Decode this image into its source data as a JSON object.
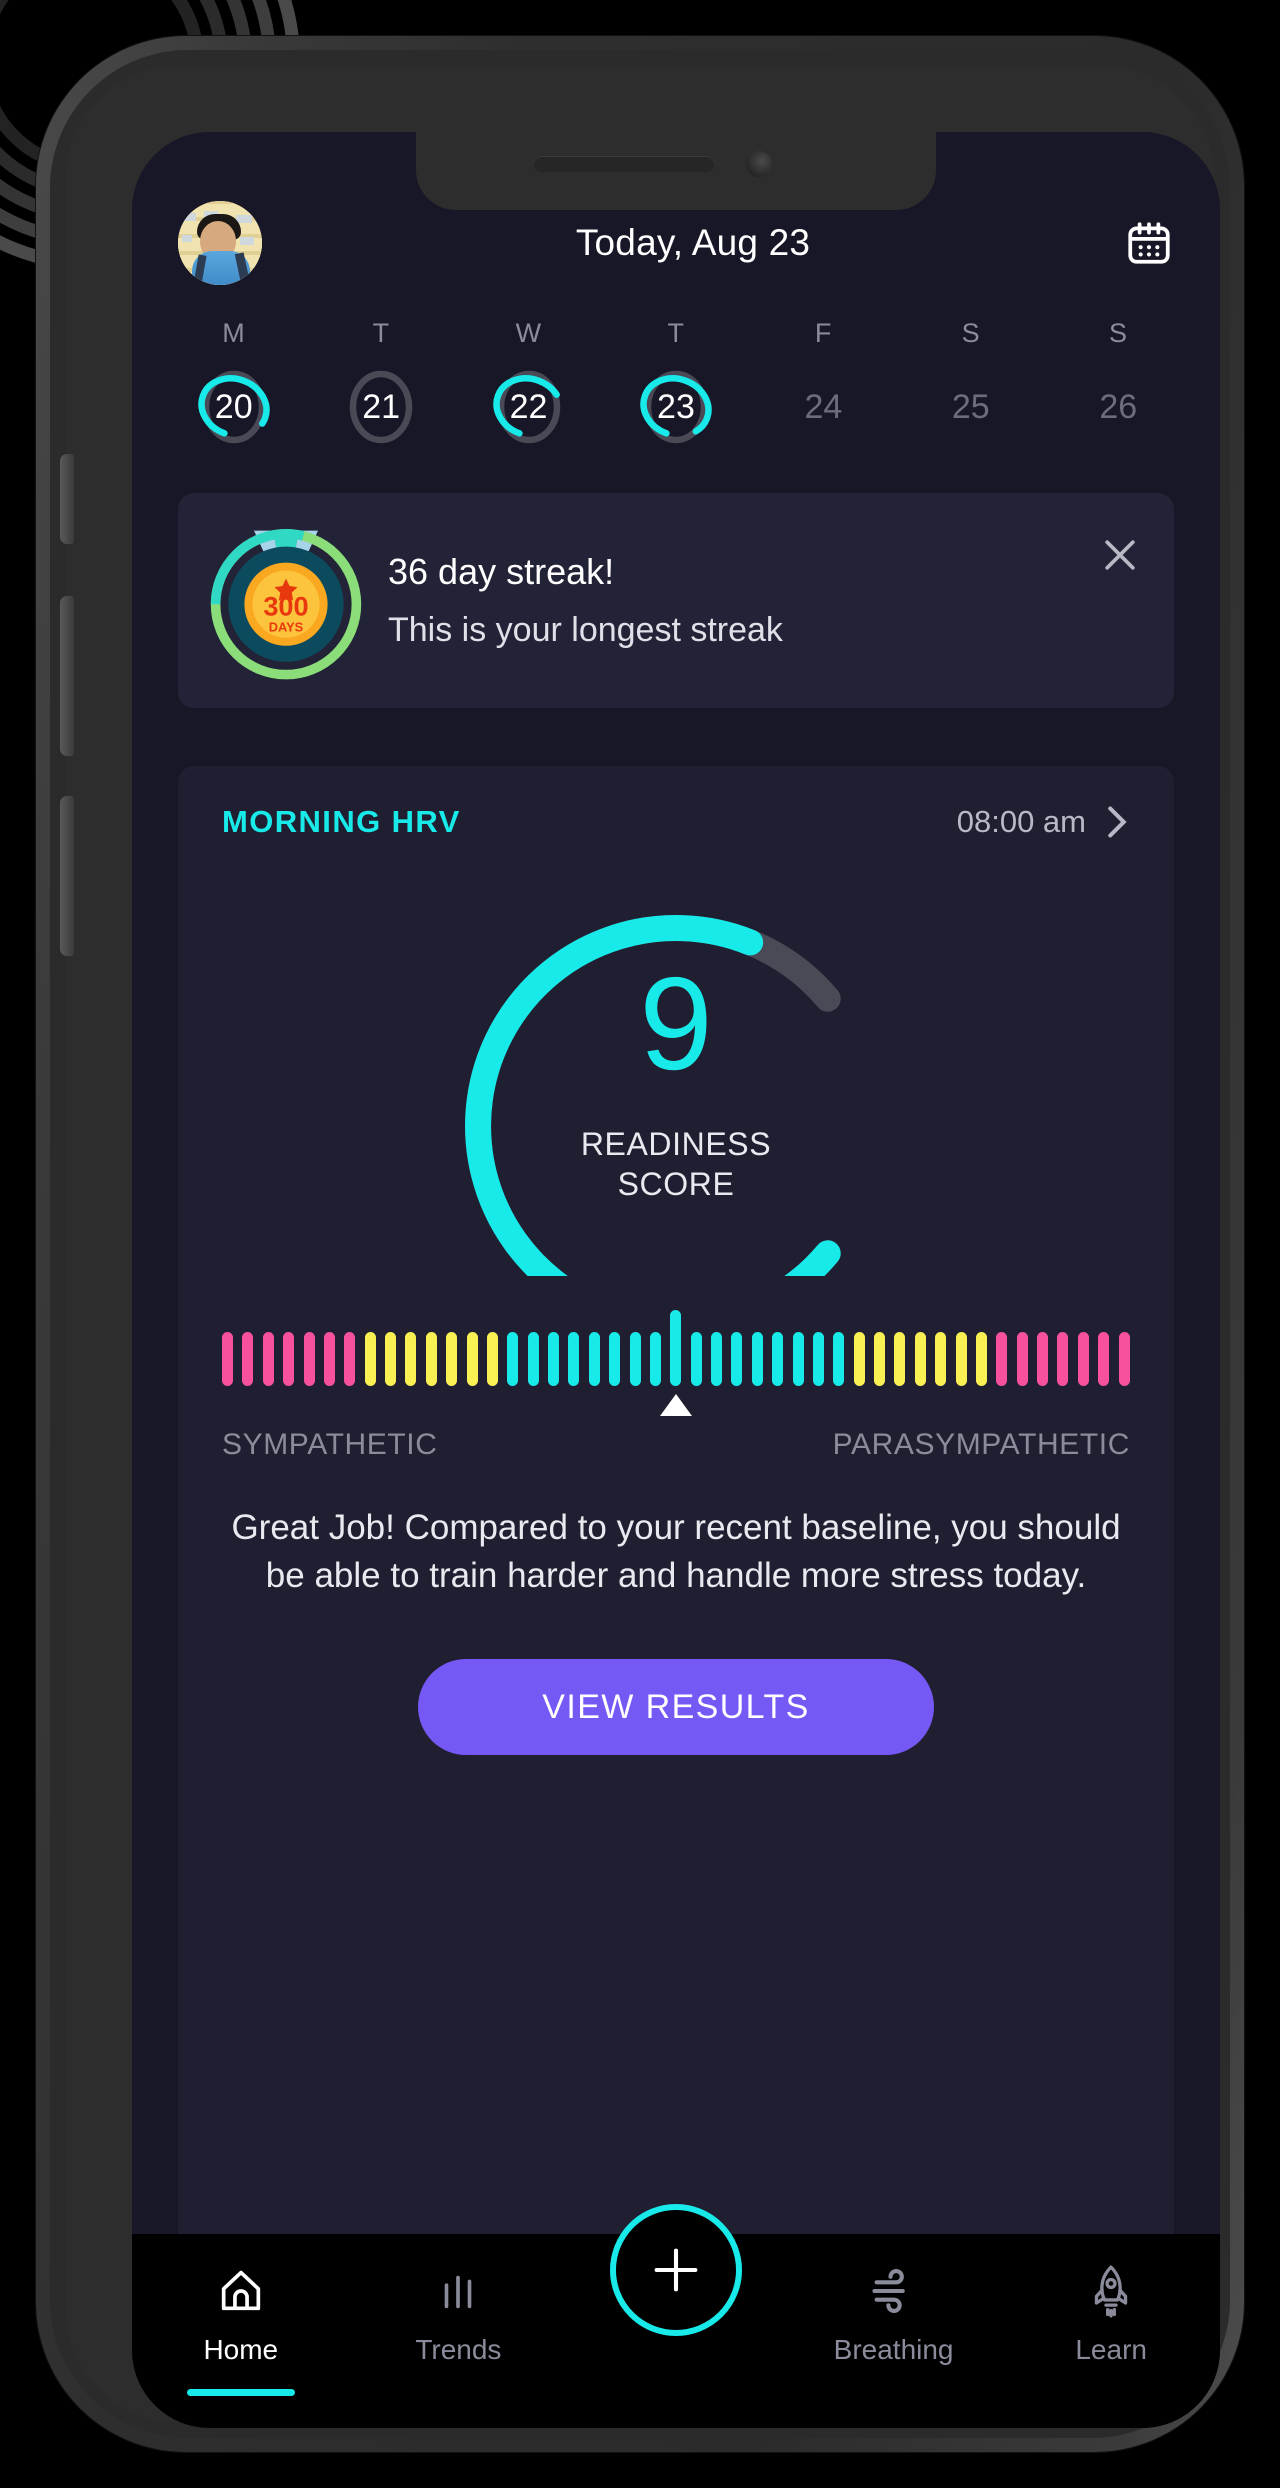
{
  "header": {
    "title": "Today, Aug 23",
    "avatar_name": "user-avatar",
    "calendar_icon": "calendar-icon"
  },
  "week": {
    "days": [
      {
        "dow": "M",
        "date": "20",
        "progress": 78,
        "active": true
      },
      {
        "dow": "T",
        "date": "21",
        "progress": 0,
        "active": true
      },
      {
        "dow": "W",
        "date": "22",
        "progress": 62,
        "active": true
      },
      {
        "dow": "T",
        "date": "23",
        "progress": 84,
        "active": true
      },
      {
        "dow": "F",
        "date": "24",
        "progress": 0,
        "active": false
      },
      {
        "dow": "S",
        "date": "25",
        "progress": 0,
        "active": false
      },
      {
        "dow": "S",
        "date": "26",
        "progress": 0,
        "active": false
      }
    ]
  },
  "streak": {
    "title": "36 day streak!",
    "subtitle": "This is your longest streak",
    "badge_number": "300",
    "badge_unit": "DAYS",
    "close_label": "close-icon"
  },
  "hrv": {
    "title": "MORNING HRV",
    "time": "08:00 am",
    "chevron": "chevron-right-icon",
    "score": "9",
    "score_label_line1": "READINESS",
    "score_label_line2": "SCORE",
    "gauge_percent": 90,
    "balance": {
      "left_label": "SYMPATHETIC",
      "right_label": "PARASYMPATHETIC",
      "pointer_percent": 50
    },
    "description": "Great Job! Compared to your recent baseline, you should be able to train harder and handle more stress today.",
    "cta_label": "VIEW RESULTS"
  },
  "nav": {
    "items": [
      {
        "label": "Home",
        "icon": "home-icon",
        "active": true
      },
      {
        "label": "Trends",
        "icon": "bar-chart-icon",
        "active": false
      },
      {
        "label": "Breathing",
        "icon": "wind-icon",
        "active": false
      },
      {
        "label": "Learn",
        "icon": "rocket-icon",
        "active": false
      }
    ],
    "add_label": "plus-icon"
  },
  "colors": {
    "accent_cyan": "#18e9e9",
    "accent_purple": "#7658f4",
    "screen_bg": "#171727",
    "card_bg": "#1f1f31",
    "streak_bg": "#232337",
    "track_gray": "#4a4a57",
    "pink": "#f7519e",
    "yellow": "#f9f053"
  },
  "chart_data": {
    "type": "bar",
    "title": "Autonomic balance",
    "categories": [
      "SYMPATHETIC",
      "PARASYMPATHETIC"
    ],
    "bar_count": 45,
    "pointer_index": 22,
    "bar_colors": [
      "#f7519e",
      "#f7519e",
      "#f7519e",
      "#f7519e",
      "#f7519e",
      "#f7519e",
      "#f7519e",
      "#f9f053",
      "#f9f053",
      "#f9f053",
      "#f9f053",
      "#f9f053",
      "#f9f053",
      "#f9f053",
      "#18e9e9",
      "#18e9e9",
      "#18e9e9",
      "#18e9e9",
      "#18e9e9",
      "#18e9e9",
      "#18e9e9",
      "#18e9e9",
      "#18e9e9",
      "#18e9e9",
      "#18e9e9",
      "#18e9e9",
      "#18e9e9",
      "#18e9e9",
      "#18e9e9",
      "#18e9e9",
      "#18e9e9",
      "#f9f053",
      "#f9f053",
      "#f9f053",
      "#f9f053",
      "#f9f053",
      "#f9f053",
      "#f9f053",
      "#f7519e",
      "#f7519e",
      "#f7519e",
      "#f7519e",
      "#f7519e",
      "#f7519e",
      "#f7519e"
    ]
  }
}
